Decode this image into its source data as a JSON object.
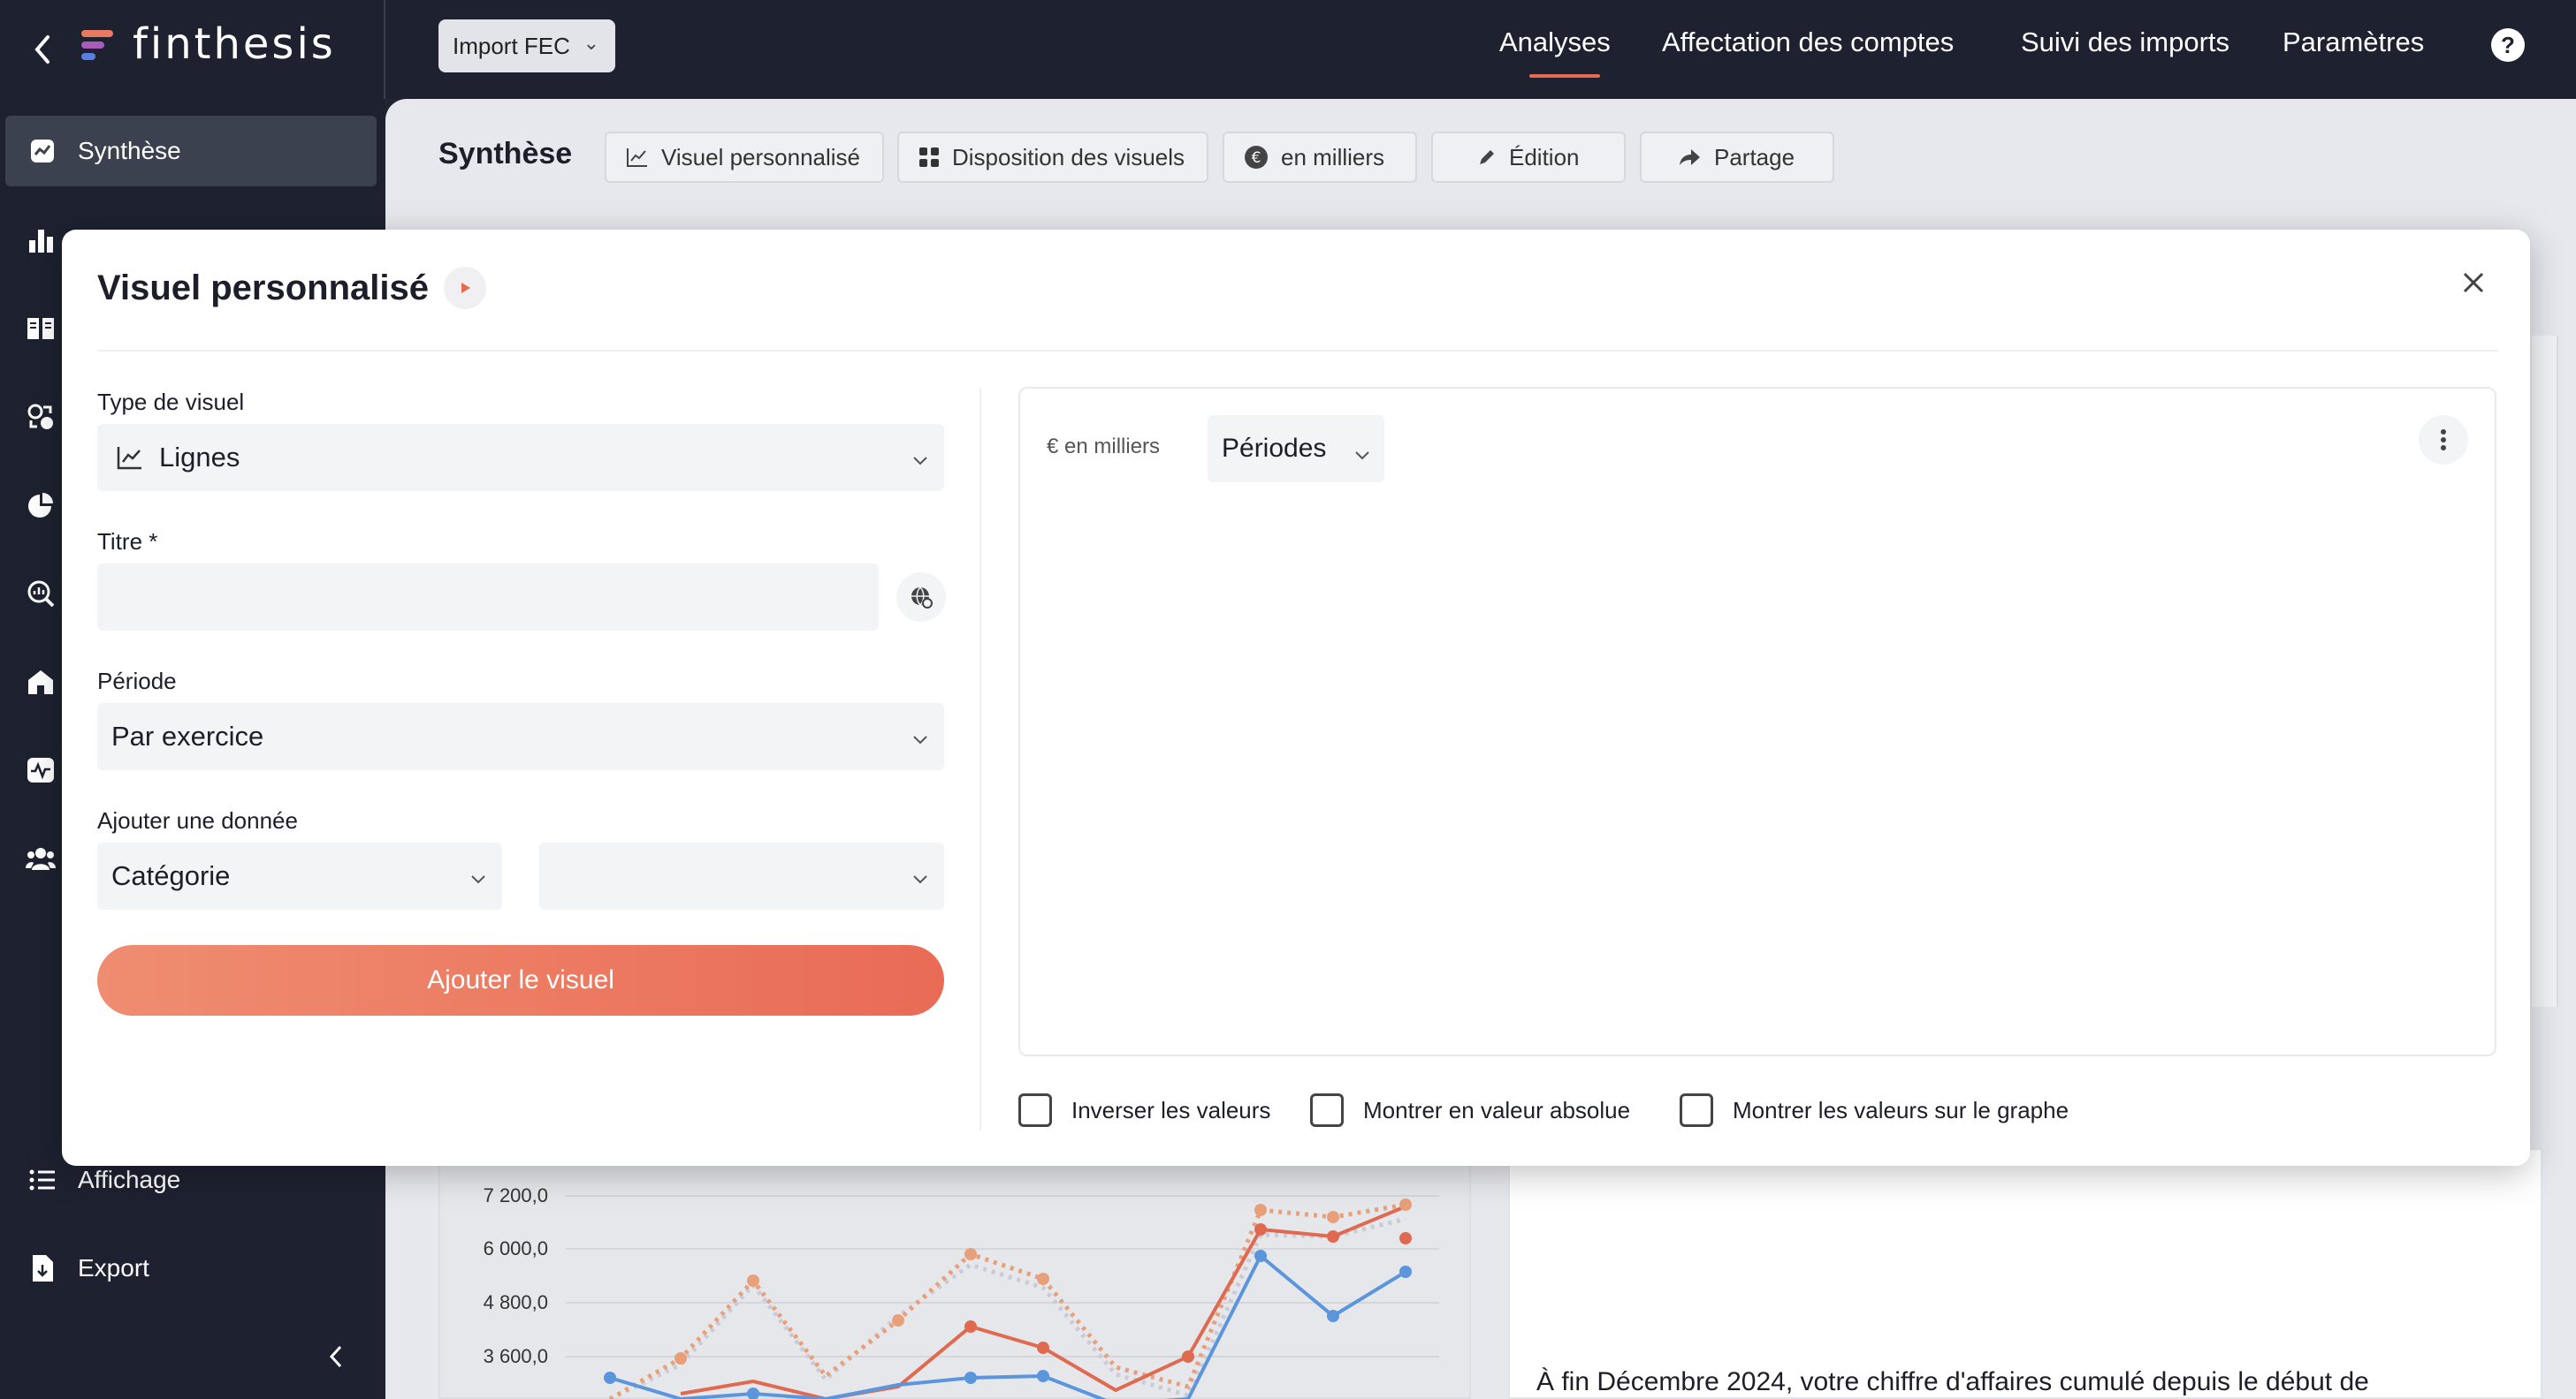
{
  "topbar": {
    "logo": "finthesis",
    "import_button": "Import FEC",
    "nav": [
      "Analyses",
      "Affectation des comptes",
      "Suivi des imports",
      "Paramètres"
    ],
    "help": "?"
  },
  "sidebar": {
    "active_item": "Synthèse",
    "bottom_items": [
      "Affichage",
      "Export"
    ]
  },
  "page": {
    "title": "Synthèse",
    "toolbar": [
      "Visuel personnalisé",
      "Disposition des visuels",
      "en milliers",
      "Édition",
      "Partage"
    ]
  },
  "background_chart": {
    "y_ticks": [
      "7 200,0",
      "6 000,0",
      "4 800,0",
      "3 600,0"
    ],
    "colors": {
      "orange_dotted": "#e8a07a",
      "red": "#e06a50",
      "blue": "#5b96dd",
      "gray_dotted": "#c9ccd6"
    }
  },
  "background_text": "À fin Décembre 2024, votre chiffre d'affaires cumulé depuis le début de",
  "modal": {
    "title": "Visuel personnalisé",
    "type_label": "Type de visuel",
    "type_value": "Lignes",
    "title_label": "Titre *",
    "title_value": "",
    "period_label": "Période",
    "period_value": "Par exercice",
    "add_data_label": "Ajouter une donnée",
    "add_data_category": "Catégorie",
    "add_data_second": "",
    "add_button": "Ajouter le visuel",
    "preview": {
      "unit": "€ en milliers",
      "period": "Périodes"
    },
    "checkboxes": [
      "Inverser les valeurs",
      "Montrer en valeur absolue",
      "Montrer les valeurs sur le graphe"
    ]
  },
  "colors": {
    "accent": "#e86a4f",
    "dark": "#1e2230"
  }
}
